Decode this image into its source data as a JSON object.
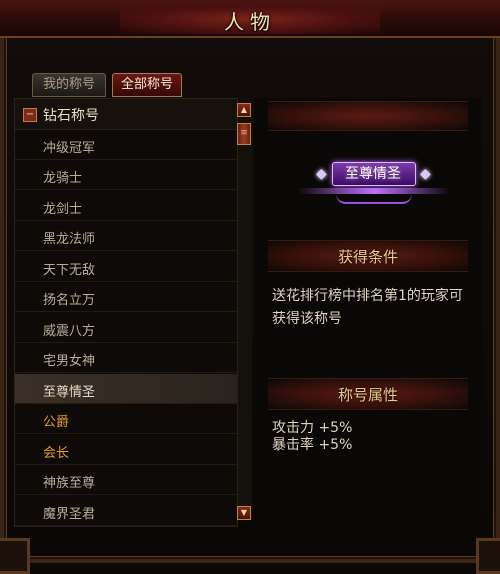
{
  "window": {
    "title": "人物"
  },
  "tabs": [
    {
      "label": "我的称号",
      "active": false
    },
    {
      "label": "全部称号",
      "active": true
    }
  ],
  "category": {
    "toggle": "−",
    "label": "钻石称号"
  },
  "titles": [
    {
      "label": "冲级冠军"
    },
    {
      "label": "龙骑士"
    },
    {
      "label": "龙剑士"
    },
    {
      "label": "黑龙法师"
    },
    {
      "label": "天下无敌"
    },
    {
      "label": "扬名立万"
    },
    {
      "label": "威震八方"
    },
    {
      "label": "宅男女神"
    },
    {
      "label": "至尊情圣",
      "selected": true
    },
    {
      "label": "公爵",
      "highlight": true
    },
    {
      "label": "会长",
      "highlight": true
    },
    {
      "label": "神族至尊"
    },
    {
      "label": "魔界圣君"
    }
  ],
  "detail": {
    "badge_text": "至尊情圣",
    "condition_heading": "获得条件",
    "condition_text": "送花排行榜中排名第1的玩家可获得该称号",
    "attr_heading": "称号属性",
    "attributes": [
      "攻击力 +5%",
      "暴击率 +5%"
    ]
  },
  "colors": {
    "accent_red": "#6a1812",
    "highlight_orange": "#e89a2a",
    "gold_text": "#e8c98a",
    "badge_purple": "#b060ff"
  },
  "icons": {
    "collapse": "minus-icon",
    "scroll_up": "arrow-up-icon",
    "scroll_down": "arrow-down-icon",
    "thumb": "grip-icon"
  }
}
